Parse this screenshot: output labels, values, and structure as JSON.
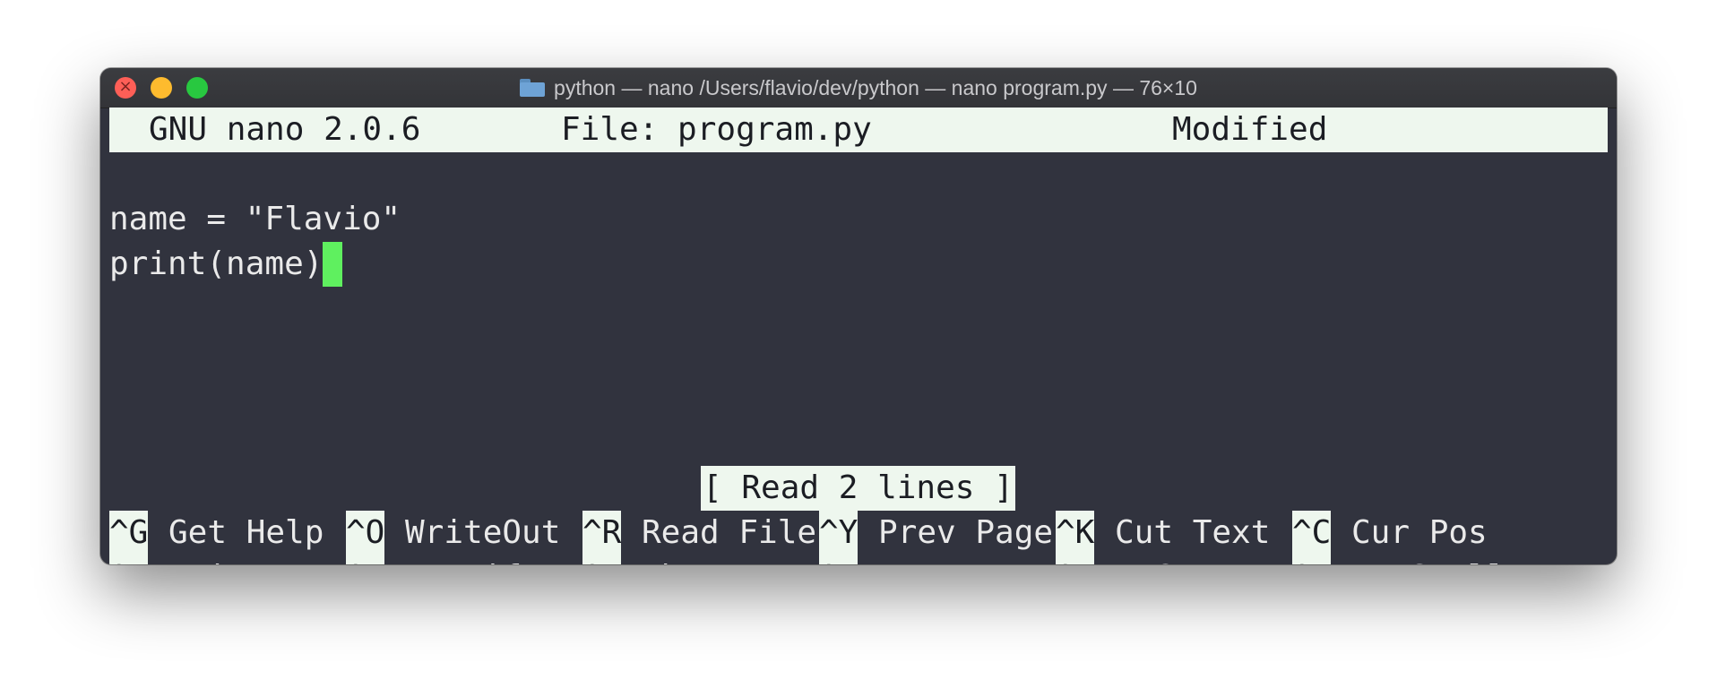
{
  "window": {
    "title": "python — nano /Users/flavio/dev/python — nano program.py — 76×10"
  },
  "nano": {
    "version": "GNU nano 2.0.6",
    "file_label": "File: program.py",
    "state": "Modified",
    "lines": [
      "",
      "name = \"Flavio\"",
      "print(name)"
    ],
    "status_message": "[ Read 2 lines ]"
  },
  "shortcuts": {
    "row1": [
      {
        "key": "^G",
        "label": "Get Help"
      },
      {
        "key": "^O",
        "label": "WriteOut"
      },
      {
        "key": "^R",
        "label": "Read File"
      },
      {
        "key": "^Y",
        "label": "Prev Page"
      },
      {
        "key": "^K",
        "label": "Cut Text"
      },
      {
        "key": "^C",
        "label": "Cur Pos"
      }
    ],
    "row2": [
      {
        "key": "^X",
        "label": "Exit"
      },
      {
        "key": "^J",
        "label": "Justify"
      },
      {
        "key": "^W",
        "label": "Where Is"
      },
      {
        "key": "^V",
        "label": "Next Page"
      },
      {
        "key": "^U",
        "label": "UnCut Tex"
      },
      {
        "key": "^T",
        "label": "To Spell"
      }
    ]
  },
  "colors": {
    "terminal_bg": "#31333e",
    "highlight_bg": "#eef7ee",
    "cursor": "#5ff05f",
    "text": "#eaeaea"
  }
}
